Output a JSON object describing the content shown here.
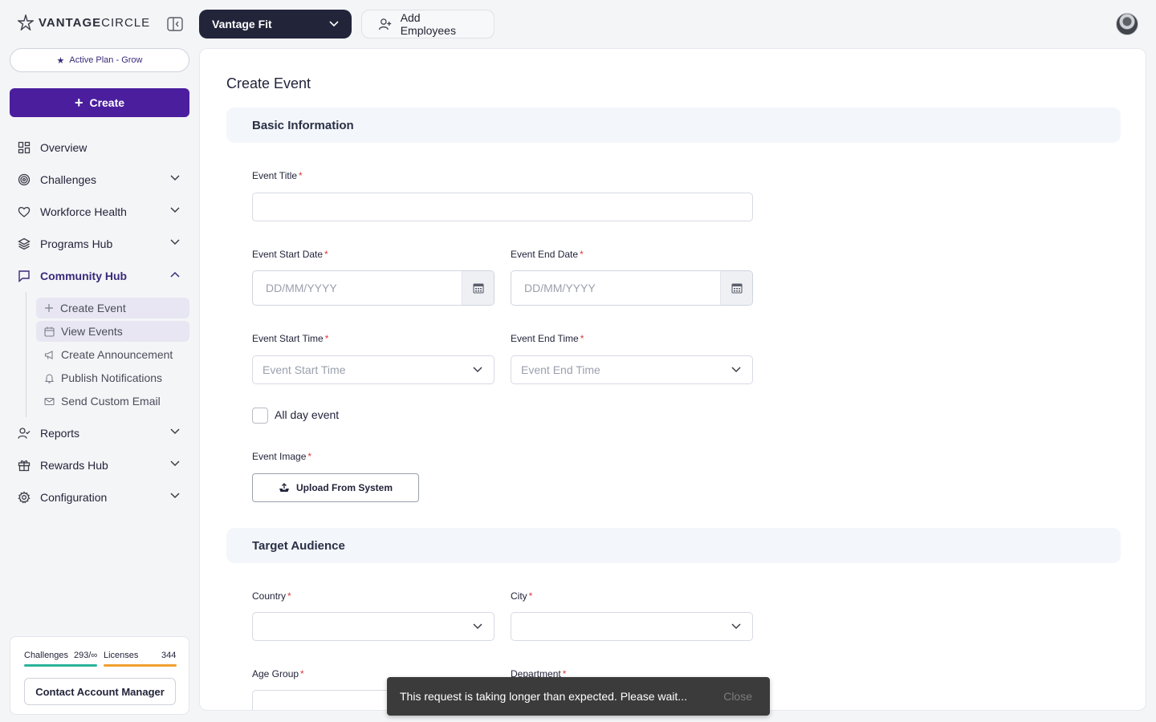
{
  "brand": {
    "logo_text_bold": "VANTAGE",
    "logo_text_light": "CIRCLE"
  },
  "header": {
    "product_selected": "Vantage Fit",
    "add_employees_label": "Add Employees"
  },
  "sidebar": {
    "plan_label": "Active Plan - Grow",
    "create_label": "Create",
    "items": [
      {
        "label": "Overview",
        "icon": "grid-icon",
        "expandable": false
      },
      {
        "label": "Challenges",
        "icon": "target-icon",
        "expandable": true
      },
      {
        "label": "Workforce Health",
        "icon": "heart-icon",
        "expandable": true
      },
      {
        "label": "Programs Hub",
        "icon": "layers-icon",
        "expandable": true
      },
      {
        "label": "Community Hub",
        "icon": "chat-icon",
        "expandable": true,
        "active": true
      }
    ],
    "community_sub": [
      {
        "label": "Create Event",
        "icon": "plus-icon"
      },
      {
        "label": "View Events",
        "icon": "calendar-icon"
      },
      {
        "label": "Create Announcement",
        "icon": "megaphone-icon"
      },
      {
        "label": "Publish Notifications",
        "icon": "bell-icon"
      },
      {
        "label": "Send Custom Email",
        "icon": "mail-icon"
      }
    ],
    "items_after": [
      {
        "label": "Reports",
        "icon": "user-check-icon"
      },
      {
        "label": "Rewards Hub",
        "icon": "gift-icon"
      },
      {
        "label": "Configuration",
        "icon": "gear-icon"
      }
    ],
    "license": {
      "challenges_label": "Challenges",
      "challenges_value": "293/∞",
      "licenses_label": "Licenses",
      "licenses_value": "344",
      "challenges_color": "#2bb39b",
      "licenses_color": "#f0a030"
    },
    "contact_label": "Contact Account Manager"
  },
  "form": {
    "page_title": "Create Event",
    "section_basic": "Basic Information",
    "event_title_label": "Event Title",
    "event_title_value": "",
    "start_date_label": "Event Start Date",
    "start_date_placeholder": "DD/MM/YYYY",
    "end_date_label": "Event End Date",
    "end_date_placeholder": "DD/MM/YYYY",
    "start_time_label": "Event Start Time",
    "start_time_placeholder": "Event Start Time",
    "end_time_label": "Event End Time",
    "end_time_placeholder": "Event End Time",
    "all_day_label": "All day event",
    "image_label": "Event Image",
    "upload_label": "Upload From System",
    "section_audience": "Target Audience",
    "country_label": "Country",
    "city_label": "City",
    "age_group_label": "Age Group",
    "department_label": "Department",
    "required_mark": "*"
  },
  "toast": {
    "message": "This request is taking longer than expected. Please wait...",
    "close_label": "Close"
  },
  "colors": {
    "accent": "#4b1e9e",
    "dark": "#22243a",
    "required": "#d93a3a"
  }
}
